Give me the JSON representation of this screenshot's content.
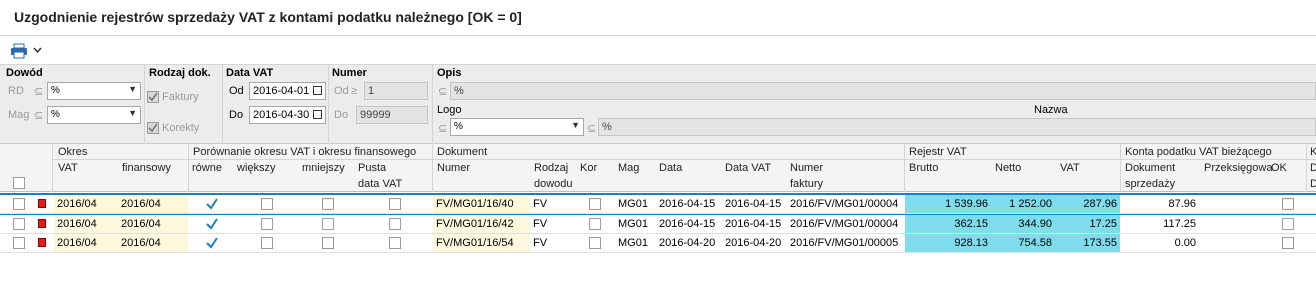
{
  "window": {
    "title": "Uzgodnienie rejestrów sprzedaży VAT z kontami podatku należnego  [OK = 0]"
  },
  "toolbar": {
    "print_icon": "printer-icon",
    "dropdown_icon": "chevron-down-icon"
  },
  "filters": {
    "dowod": {
      "label": "Dowód",
      "rd_label": "RD",
      "rd_op": "⊆",
      "rd_value": "%",
      "mag_label": "Mag",
      "mag_op": "⊆",
      "mag_value": "%"
    },
    "rodzaj": {
      "label": "Rodzaj dok.",
      "faktury": "Faktury",
      "korekty": "Korekty"
    },
    "data_vat": {
      "label": "Data VAT",
      "od_label": "Od",
      "od_value": "2016-04-01",
      "do_label": "Do",
      "do_value": "2016-04-30"
    },
    "numer": {
      "label": "Numer",
      "od_label": "Od",
      "od_op": "≥",
      "od_value": "1",
      "do_label": "Do",
      "do_value": "99999"
    },
    "opis": {
      "label": "Opis",
      "op": "⊆",
      "value": "%"
    },
    "logo": {
      "label": "Logo",
      "op": "⊆",
      "value": "%"
    },
    "nazwa": {
      "label": "Nazwa",
      "op": "⊆",
      "value": "%"
    }
  },
  "grid": {
    "groups": {
      "okres": "Okres",
      "porownanie": "Porównanie okresu VAT i okresu finansowego",
      "dokument": "Dokument",
      "rejestr": "Rejestr VAT",
      "konta": "Konta podatku VAT bieżącego",
      "extra": "K"
    },
    "cols": {
      "vat": "VAT",
      "finansowy": "finansowy",
      "rowne": "równe",
      "wieksz": "większy",
      "mniejszy": "mniejszy",
      "pusta1": "Pusta",
      "pusta2": "data VAT",
      "numer": "Numer",
      "rodzaj1": "Rodzaj",
      "rodzaj2": "dowodu",
      "kor": "Kor",
      "mag": "Mag",
      "data": "Data",
      "data_vat": "Data VAT",
      "nfak1": "Numer",
      "nfak2": "faktury",
      "brutto": "Brutto",
      "netto": "Netto",
      "vatcol": "VAT",
      "dok1": "Dokument",
      "dok2": "sprzedaży",
      "przeks": "Przeksięgowa",
      "ok": "OK",
      "d1": "D",
      "d2": "D"
    },
    "rows": [
      {
        "okres_vat": "2016/04",
        "okres_fin": "2016/04",
        "numer": "FV/MG01/16/40",
        "rodzaj": "FV",
        "mag": "MG01",
        "data": "2016-04-15",
        "data_vat": "2016-04-15",
        "nr_faktury": "2016/FV/MG01/00004",
        "brutto": "1 539.96",
        "netto": "1 252.00",
        "vat": "287.96",
        "dok_sprzedazy": "87.96"
      },
      {
        "okres_vat": "2016/04",
        "okres_fin": "2016/04",
        "numer": "FV/MG01/16/42",
        "rodzaj": "FV",
        "mag": "MG01",
        "data": "2016-04-15",
        "data_vat": "2016-04-15",
        "nr_faktury": "2016/FV/MG01/00004",
        "brutto": "362.15",
        "netto": "344.90",
        "vat": "17.25",
        "dok_sprzedazy": "117.25"
      },
      {
        "okres_vat": "2016/04",
        "okres_fin": "2016/04",
        "numer": "FV/MG01/16/54",
        "rodzaj": "FV",
        "mag": "MG01",
        "data": "2016-04-20",
        "data_vat": "2016-04-20",
        "nr_faktury": "2016/FV/MG01/00005",
        "brutto": "928.13",
        "netto": "754.58",
        "vat": "173.55",
        "dok_sprzedazy": "0.00"
      }
    ]
  },
  "colors": {
    "accent": "#1e7fc0",
    "yellow_cell": "#fcf8de",
    "cyan_cell": "#7fdcec",
    "flag": "#e01b1b"
  }
}
